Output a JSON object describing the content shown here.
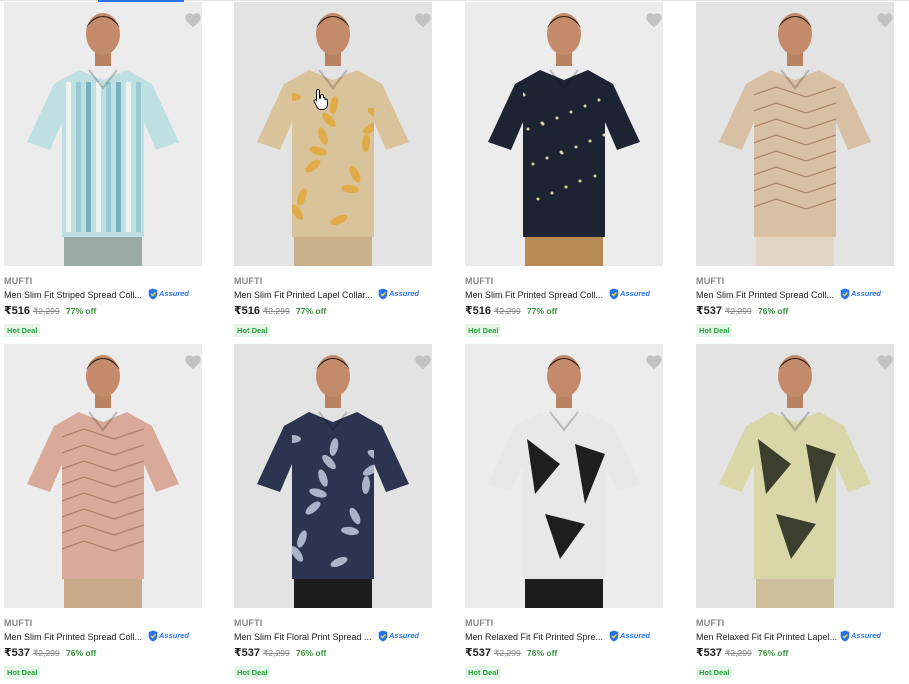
{
  "assured_label": "Assured",
  "colors": {
    "discount": "#388e3c",
    "badge_text": "#26a541",
    "badge_bg": "#e6f7ea",
    "assured": "#2874f0"
  },
  "icons": {
    "wishlist": "heart-icon",
    "assured": "shield-icon",
    "cursor": "hand-pointer-icon"
  },
  "products": [
    {
      "brand": "MUFTI",
      "title": "Men Slim Fit Striped Spread Coll...",
      "price": "₹516",
      "mrp": "₹2,299",
      "discount": "77% off",
      "badge": "Hot Deal",
      "shirt_color": "#bfe0e2",
      "pattern": "stripes",
      "pants_color": "#9aaba5"
    },
    {
      "brand": "MUFTI",
      "title": "Men Slim Fit Printed Lapel Collar...",
      "price": "₹516",
      "mrp": "₹2,299",
      "discount": "77% off",
      "badge": "Hot Deal",
      "shirt_color": "#d9c39a",
      "pattern": "leaves",
      "pants_color": "#c9b08a"
    },
    {
      "brand": "MUFTI",
      "title": "Men Slim Fit Printed Spread Coll...",
      "price": "₹516",
      "mrp": "₹2,299",
      "discount": "77% off",
      "badge": "Hot Deal",
      "shirt_color": "#1c2434",
      "pattern": "dots",
      "pants_color": "#b88a55"
    },
    {
      "brand": "MUFTI",
      "title": "Men Slim Fit Printed Spread Coll...",
      "price": "₹537",
      "mrp": "₹2,299",
      "discount": "76% off",
      "badge": "Hot Deal",
      "shirt_color": "#d8c0a4",
      "pattern": "geo",
      "pants_color": "#e0d6c2"
    },
    {
      "brand": "MUFTI",
      "title": "Men Slim Fit Printed Spread Coll...",
      "price": "₹537",
      "mrp": "₹2,299",
      "discount": "76% off",
      "badge": "Hot Deal",
      "shirt_color": "#d9a99a",
      "pattern": "geo",
      "pants_color": "#c7a98a"
    },
    {
      "brand": "MUFTI",
      "title": "Men Slim Fit Floral Print Spread ...",
      "price": "₹537",
      "mrp": "₹2,299",
      "discount": "76% off",
      "badge": "Hot Deal",
      "shirt_color": "#2b3550",
      "pattern": "leaves",
      "pants_color": "#1d1d1d"
    },
    {
      "brand": "MUFTI",
      "title": "Men Relaxed Fit Fit Printed Spre...",
      "price": "₹537",
      "mrp": "₹2,299",
      "discount": "76% off",
      "badge": "Hot Deal",
      "shirt_color": "#e8e8e8",
      "pattern": "bold",
      "pants_color": "#1d1d1d"
    },
    {
      "brand": "MUFTI",
      "title": "Men Relaxed Fit Fit Printed Lapel...",
      "price": "₹537",
      "mrp": "₹2,299",
      "discount": "76% off",
      "badge": "Hot Deal",
      "shirt_color": "#d9d6a8",
      "pattern": "bold",
      "pants_color": "#cdbf9e"
    }
  ]
}
